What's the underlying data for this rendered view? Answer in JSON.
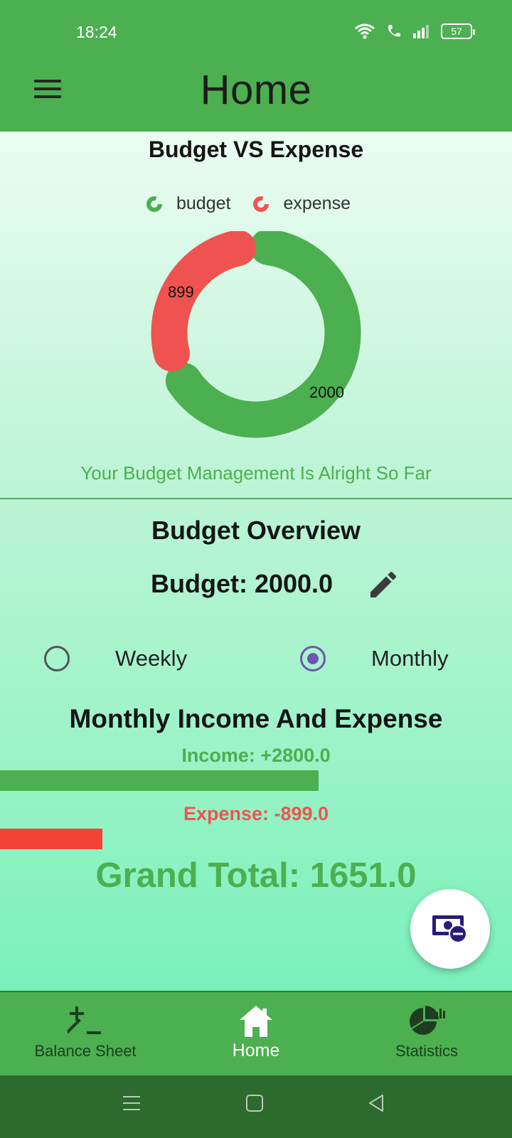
{
  "status_bar": {
    "time": "18:24",
    "battery": "57"
  },
  "app_bar": {
    "title": "Home"
  },
  "chart": {
    "title": "Budget VS Expense",
    "legend": [
      "budget",
      "expense"
    ],
    "budget_label": "2000",
    "expense_label": "899",
    "message": "Your Budget Management Is Alright So Far"
  },
  "chart_data": {
    "type": "pie",
    "title": "Budget VS Expense",
    "categories": [
      "budget",
      "expense"
    ],
    "values": [
      2000,
      899
    ],
    "colors": [
      "#4caf50",
      "#ef5350"
    ],
    "legend_position": "top"
  },
  "overview": {
    "title": "Budget Overview",
    "budget_text": "Budget: 2000.0",
    "period_options": [
      "Weekly",
      "Monthly"
    ],
    "selected_period": "Monthly"
  },
  "income_expense": {
    "title": "Monthly Income And Expense",
    "income_text": "Income: +2800.0",
    "expense_text": "Expense: -899.0",
    "income_value": 2800,
    "expense_value": 899,
    "grand_total_text": "Grand Total: 1651.0"
  },
  "colors": {
    "primary": "#4caf50",
    "expense": "#ef5350",
    "radio_selected": "#6e55b3"
  },
  "bottom_nav": {
    "items": [
      {
        "label": "Balance Sheet",
        "icon": "plus-minus-icon"
      },
      {
        "label": "Home",
        "icon": "home-icon"
      },
      {
        "label": "Statistics",
        "icon": "pie-chart-icon"
      }
    ],
    "active": "Home"
  }
}
